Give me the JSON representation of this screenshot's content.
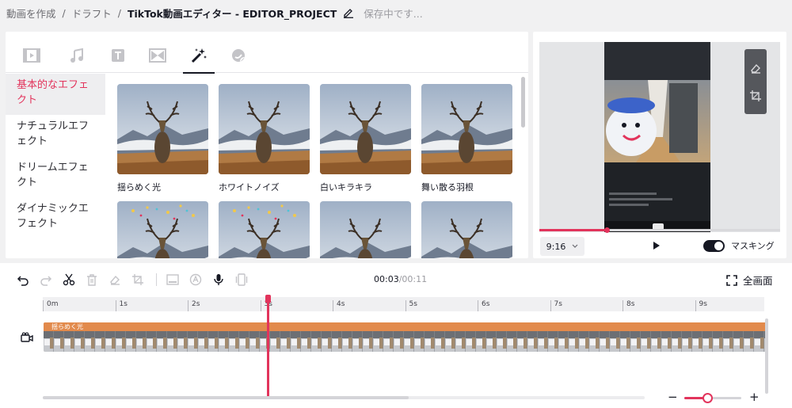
{
  "breadcrumb": {
    "items": [
      "動画を作成",
      "ドラフト"
    ],
    "separator": "/",
    "current": "TikTok動画エディター - EDITOR_PROJECT",
    "status": "保存中です..."
  },
  "effects": {
    "tabs": [
      {
        "icon": "video-icon",
        "active": false
      },
      {
        "icon": "music-icon",
        "active": false
      },
      {
        "icon": "text-icon",
        "active": false
      },
      {
        "icon": "transition-icon",
        "active": false
      },
      {
        "icon": "effects-wand-icon",
        "active": true
      },
      {
        "icon": "sticker-icon",
        "active": false
      }
    ],
    "categories": [
      "基本的なエフェクト",
      "ナチュラルエフェクト",
      "ドリームエフェクト",
      "ダイナミックエフェクト"
    ],
    "active_category": 0,
    "items": [
      {
        "label": "揺らめく光"
      },
      {
        "label": "ホワイトノイズ"
      },
      {
        "label": "白いキラキラ"
      },
      {
        "label": "舞い散る羽根"
      },
      {
        "label": ""
      },
      {
        "label": ""
      },
      {
        "label": ""
      },
      {
        "label": ""
      }
    ]
  },
  "preview": {
    "aspect_ratio": "9:16",
    "masking_label": "マスキング",
    "masking_on": true,
    "progress": 0.28,
    "side_tools": [
      "eraser-icon",
      "crop-icon"
    ]
  },
  "timeline": {
    "tools": [
      "undo-icon",
      "redo-icon",
      "scissors-icon",
      "trash-icon",
      "eraser-icon",
      "crop-icon",
      "subtitle-icon",
      "auto-caption-icon",
      "microphone-icon",
      "freeze-icon"
    ],
    "current_time": "00:03",
    "total_time": "/00:11",
    "fullscreen_label": "全画面",
    "ruler": [
      "0m",
      "1s",
      "2s",
      "3s",
      "4s",
      "5s",
      "6s",
      "7s",
      "8s",
      "9s"
    ],
    "clip_label": "揺らめく光",
    "playhead_seconds": 3.1,
    "zoom_level": 0.4
  },
  "colors": {
    "accent": "#e2345c",
    "clip_tag": "#e28a4c",
    "text": "#161823"
  }
}
